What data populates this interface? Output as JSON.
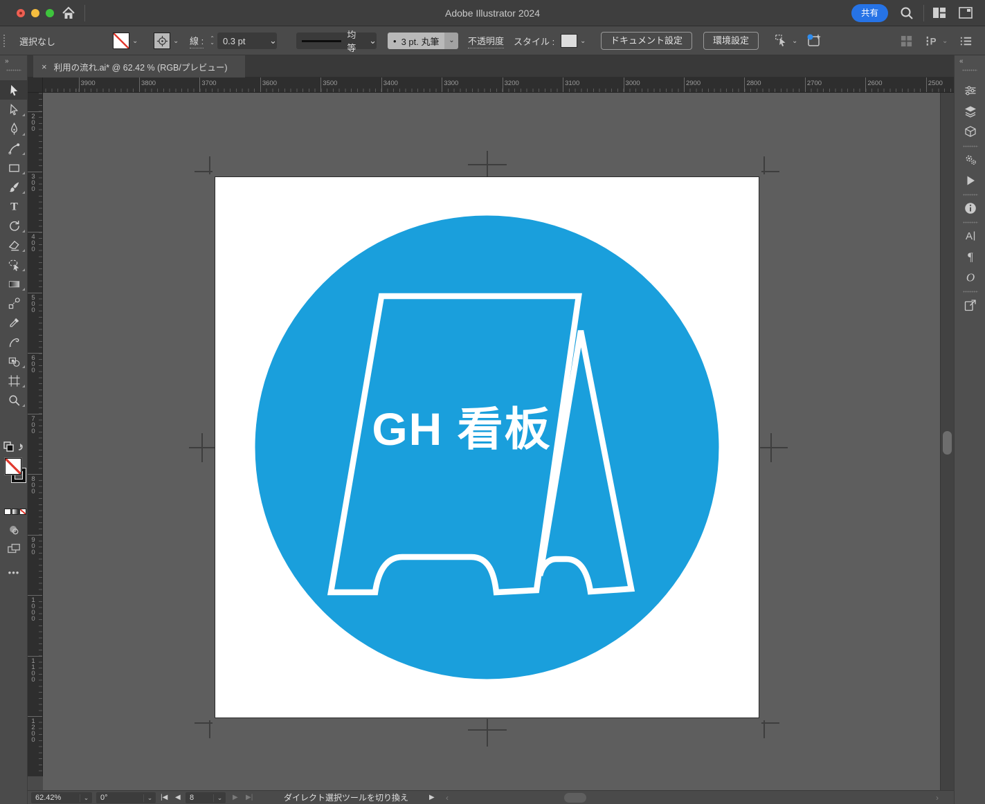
{
  "titlebar": {
    "title": "Adobe Illustrator 2024",
    "share_label": "共有"
  },
  "controlbar": {
    "selection_status": "選択なし",
    "stroke_label": "線 :",
    "stroke_width": "0.3 pt",
    "stroke_variable_width": "均等",
    "brush_dot": "•",
    "brush": "3 pt. 丸筆",
    "opacity_label": "不透明度",
    "style_label": "スタイル :",
    "document_setup_label": "ドキュメント設定",
    "preferences_label": "環境設定"
  },
  "tab": {
    "close": "×",
    "title": "利用の流れ.ai* @ 62.42 % (RGB/プレビュー)"
  },
  "rulers": {
    "horizontal": [
      "3900",
      "3800",
      "3700",
      "3600",
      "3500",
      "3400",
      "3300",
      "3200",
      "3100",
      "3000",
      "2900",
      "2800",
      "2700",
      "2600",
      "2500"
    ],
    "vertical": [
      "200",
      "300",
      "400",
      "500",
      "600",
      "700",
      "800",
      "900",
      "1000",
      "1100",
      "1200"
    ]
  },
  "artwork": {
    "label": "GH 看板",
    "circle_color": "#1A9FDC",
    "line_color": "#FFFFFF",
    "artboard_color": "#FFFFFF"
  },
  "tools": [
    "selection-tool",
    "direct-selection-tool",
    "pen-tool",
    "curvature-tool",
    "rectangle-tool",
    "paintbrush-tool",
    "type-tool",
    "rotate-tool",
    "eraser-tool",
    "lasso-tool",
    "gradient-tool",
    "blend-tool",
    "eyedropper-tool",
    "shaper-tool",
    "shape-builder-tool",
    "artboard-tool",
    "zoom-tool"
  ],
  "right_panel": [
    [
      "properties",
      "layers",
      "3d-and-materials"
    ],
    [
      "actions",
      "play-action"
    ],
    [
      "info"
    ],
    [
      "character",
      "paragraph",
      "opentype"
    ],
    [
      "export"
    ]
  ],
  "statusbar": {
    "zoom": "62.42%",
    "rotation": "0°",
    "artboard_number": "8",
    "hint": "ダイレクト選択ツールを切り換え"
  }
}
